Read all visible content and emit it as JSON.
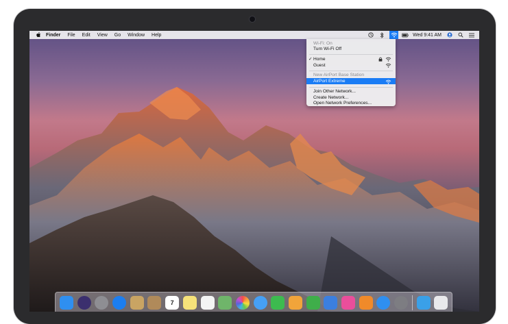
{
  "menubar": {
    "app_name": "Finder",
    "menus": [
      "File",
      "Edit",
      "View",
      "Go",
      "Window",
      "Help"
    ],
    "clock": "Wed 9:41 AM"
  },
  "wifi_menu": {
    "status": "Wi-Fi: On",
    "toggle": "Turn Wi-Fi Off",
    "networks": [
      {
        "name": "Home",
        "checked": true,
        "locked": true
      },
      {
        "name": "Guest",
        "checked": false,
        "locked": false
      }
    ],
    "base_station_header": "New AirPort Base Station",
    "base_station": "AirPort Extreme",
    "actions": [
      "Join Other Network...",
      "Create Network...",
      "Open Network Preferences..."
    ]
  },
  "dock": {
    "apps": [
      {
        "icon": "finder-icon",
        "color": "#2f8ff0"
      },
      {
        "icon": "siri-icon",
        "color": "#3b2f6e"
      },
      {
        "icon": "launchpad-icon",
        "color": "#8e8e93"
      },
      {
        "icon": "safari-icon",
        "color": "#1c7ef0"
      },
      {
        "icon": "photo-viewer-icon",
        "color": "#c9a463"
      },
      {
        "icon": "contacts-icon",
        "color": "#b08a5a"
      },
      {
        "icon": "calendar-icon",
        "color": "#ffffff",
        "text": "7"
      },
      {
        "icon": "notes-icon",
        "color": "#f6e27a"
      },
      {
        "icon": "reminders-icon",
        "color": "#f4f4f4"
      },
      {
        "icon": "maps-icon",
        "color": "#6fb56a"
      },
      {
        "icon": "photos-icon",
        "color": "#ffffff"
      },
      {
        "icon": "messages-icon",
        "color": "#46a0f5"
      },
      {
        "icon": "facetime-icon",
        "color": "#3dbb4f"
      },
      {
        "icon": "pages-icon",
        "color": "#f1a43a"
      },
      {
        "icon": "numbers-icon",
        "color": "#3fae4a"
      },
      {
        "icon": "keynote-icon",
        "color": "#3b7fe0"
      },
      {
        "icon": "itunes-icon",
        "color": "#ea4e9b"
      },
      {
        "icon": "ibooks-icon",
        "color": "#f08a2a"
      },
      {
        "icon": "app-store-icon",
        "color": "#2f8ff0"
      },
      {
        "icon": "system-preferences-icon",
        "color": "#7d7d82"
      }
    ],
    "after_divider": [
      {
        "icon": "downloads-folder-icon",
        "color": "#3aa0e8"
      },
      {
        "icon": "trash-icon",
        "color": "#e9e9ec"
      }
    ]
  }
}
